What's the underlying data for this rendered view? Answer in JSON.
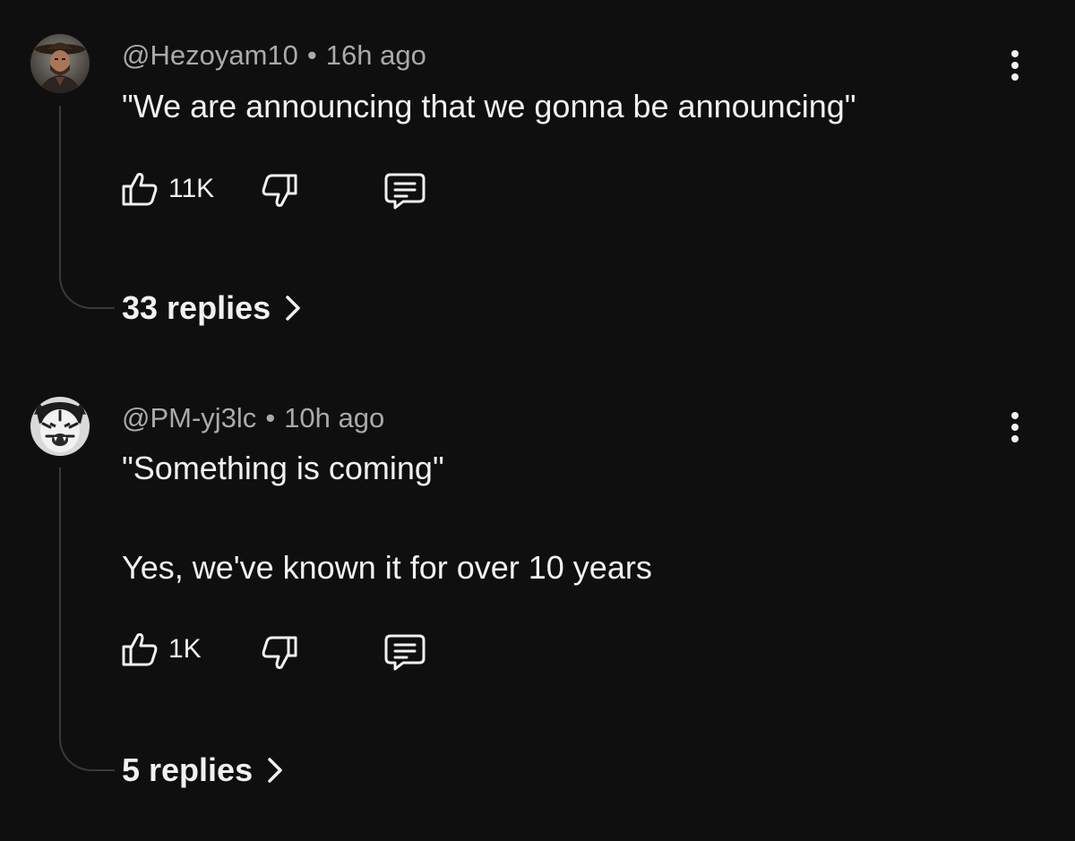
{
  "comments": [
    {
      "author": "@Hezoyam10",
      "separator": "•",
      "time": "16h ago",
      "lines": [
        "\"We are announcing that we gonna be announcing\""
      ],
      "likes": "11K",
      "replies": "33 replies",
      "avatar": "cowboy-avatar"
    },
    {
      "author": "@PM-yj3lc",
      "separator": "•",
      "time": "10h ago",
      "lines": [
        "\"Something is coming\"",
        "Yes, we've known it for over 10 years"
      ],
      "likes": "1K",
      "replies": "5 replies",
      "avatar": "tiger-avatar"
    }
  ],
  "icons": {
    "like": "thumbs-up-icon",
    "dislike": "thumbs-down-icon",
    "reply": "reply-bubble-icon",
    "more": "more-vertical-icon",
    "chevron": "chevron-right-icon"
  },
  "colors": {
    "background": "#0f0f0f",
    "text": "#f1f1f1",
    "secondary_text": "#aaaaaa",
    "thread_line": "#3a3a3a"
  }
}
